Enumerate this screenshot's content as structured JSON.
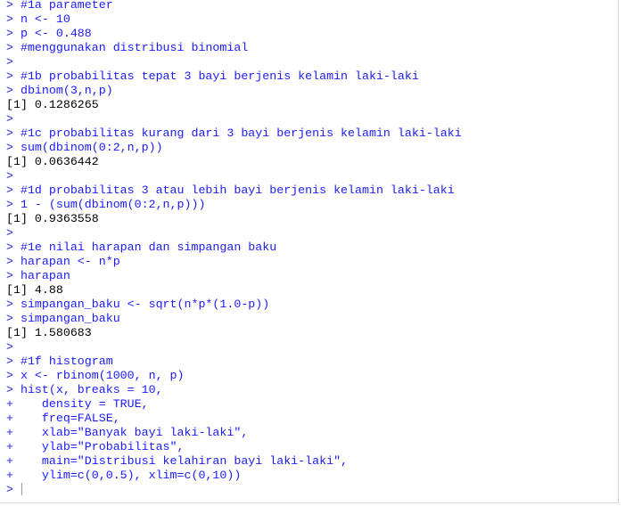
{
  "lines": [
    {
      "type": "cmd",
      "prompt": "> ",
      "text": "#1a parameter"
    },
    {
      "type": "cmd",
      "prompt": "> ",
      "text": "n <- 10"
    },
    {
      "type": "cmd",
      "prompt": "> ",
      "text": "p <- 0.488"
    },
    {
      "type": "cmd",
      "prompt": "> ",
      "text": "#menggunakan distribusi binomial"
    },
    {
      "type": "cmd",
      "prompt": "> ",
      "text": ""
    },
    {
      "type": "cmd",
      "prompt": "> ",
      "text": "#1b probabilitas tepat 3 bayi berjenis kelamin laki-laki"
    },
    {
      "type": "cmd",
      "prompt": "> ",
      "text": "dbinom(3,n,p)"
    },
    {
      "type": "out",
      "prompt": "",
      "text": "[1] 0.1286265"
    },
    {
      "type": "cmd",
      "prompt": "> ",
      "text": ""
    },
    {
      "type": "cmd",
      "prompt": "> ",
      "text": "#1c probabilitas kurang dari 3 bayi berjenis kelamin laki-laki"
    },
    {
      "type": "cmd",
      "prompt": "> ",
      "text": "sum(dbinom(0:2,n,p))"
    },
    {
      "type": "out",
      "prompt": "",
      "text": "[1] 0.0636442"
    },
    {
      "type": "cmd",
      "prompt": "> ",
      "text": ""
    },
    {
      "type": "cmd",
      "prompt": "> ",
      "text": "#1d probabilitas 3 atau lebih bayi berjenis kelamin laki-laki"
    },
    {
      "type": "cmd",
      "prompt": "> ",
      "text": "1 - (sum(dbinom(0:2,n,p)))"
    },
    {
      "type": "out",
      "prompt": "",
      "text": "[1] 0.9363558"
    },
    {
      "type": "cmd",
      "prompt": "> ",
      "text": ""
    },
    {
      "type": "cmd",
      "prompt": "> ",
      "text": "#1e nilai harapan dan simpangan baku"
    },
    {
      "type": "cmd",
      "prompt": "> ",
      "text": "harapan <- n*p"
    },
    {
      "type": "cmd",
      "prompt": "> ",
      "text": "harapan"
    },
    {
      "type": "out",
      "prompt": "",
      "text": "[1] 4.88"
    },
    {
      "type": "cmd",
      "prompt": "> ",
      "text": "simpangan_baku <- sqrt(n*p*(1.0-p))"
    },
    {
      "type": "cmd",
      "prompt": "> ",
      "text": "simpangan_baku"
    },
    {
      "type": "out",
      "prompt": "",
      "text": "[1] 1.580683"
    },
    {
      "type": "cmd",
      "prompt": "> ",
      "text": ""
    },
    {
      "type": "cmd",
      "prompt": "> ",
      "text": "#1f histogram"
    },
    {
      "type": "cmd",
      "prompt": "> ",
      "text": "x <- rbinom(1000, n, p)"
    },
    {
      "type": "cmd",
      "prompt": "> ",
      "text": "hist(x, breaks = 10,"
    },
    {
      "type": "cmd",
      "prompt": "+ ",
      "text": "   density = TRUE,"
    },
    {
      "type": "cmd",
      "prompt": "+ ",
      "text": "   freq=FALSE,"
    },
    {
      "type": "cmd",
      "prompt": "+ ",
      "text": "   xlab=\"Banyak bayi laki-laki\","
    },
    {
      "type": "cmd",
      "prompt": "+ ",
      "text": "   ylab=\"Probabilitas\","
    },
    {
      "type": "cmd",
      "prompt": "+ ",
      "text": "   main=\"Distribusi kelahiran bayi laki-laki\","
    },
    {
      "type": "cmd",
      "prompt": "+ ",
      "text": "   ylim=c(0,0.5), xlim=c(0,10))"
    }
  ],
  "input_prompt": "> "
}
